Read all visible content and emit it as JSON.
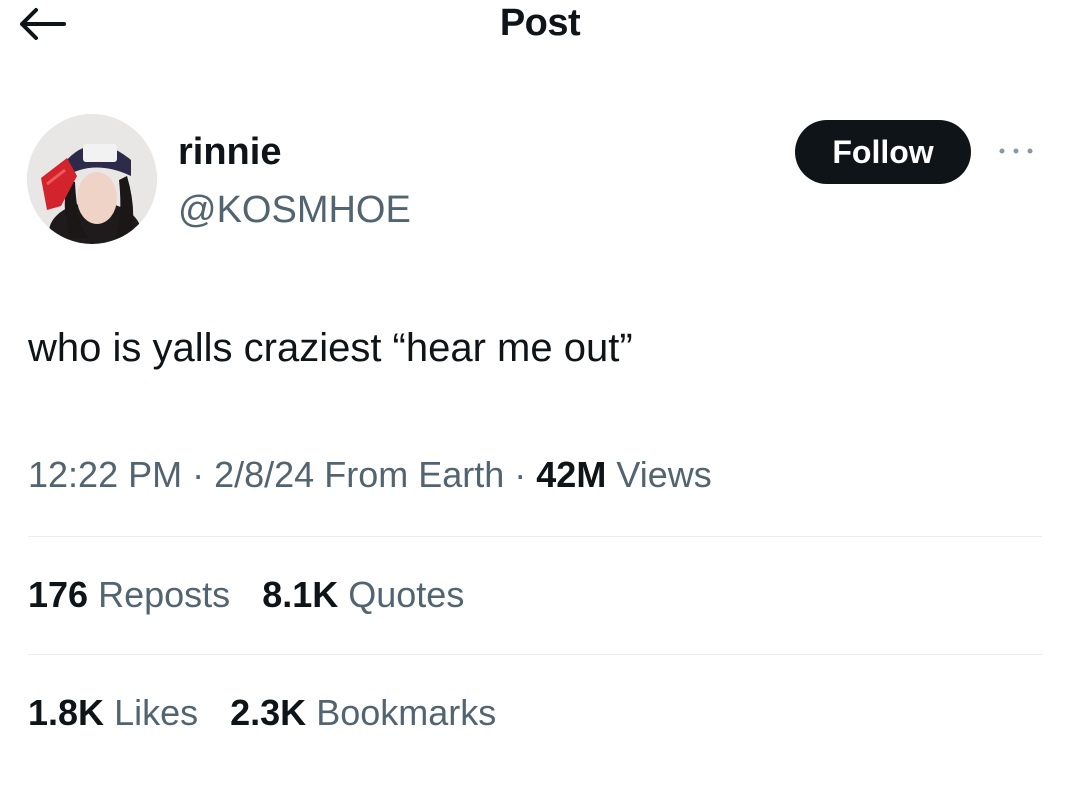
{
  "header": {
    "title": "Post",
    "back_icon": "arrow-left-icon"
  },
  "author": {
    "display_name": "rinnie",
    "handle": "@KOSMHOE",
    "follow_label": "Follow",
    "more_icon": "more-horizontal-icon"
  },
  "post": {
    "text": "who is yalls craziest “hear me out”",
    "time": "12:22 PM",
    "date": "2/8/24",
    "location": "From Earth",
    "views_count": "42M",
    "views_label": "Views"
  },
  "stats": {
    "reposts": {
      "count": "176",
      "label": "Reposts"
    },
    "quotes": {
      "count": "8.1K",
      "label": "Quotes"
    },
    "likes": {
      "count": "1.8K",
      "label": "Likes"
    },
    "bookmarks": {
      "count": "2.3K",
      "label": "Bookmarks"
    }
  },
  "colors": {
    "text_primary": "#0f1419",
    "text_secondary": "#536471",
    "follow_bg": "#0f1419",
    "divider": "#e6ecf0"
  }
}
